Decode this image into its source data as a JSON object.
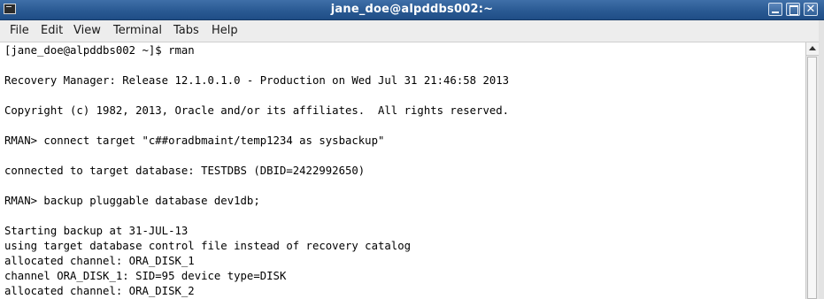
{
  "window": {
    "title": "jane_doe@alpddbs002:~",
    "app_icon": "terminal-icon",
    "controls": {
      "minimize_icon": "minimize-icon",
      "maximize_icon": "maximize-icon",
      "close_icon": "close-icon",
      "close_glyph": "✕"
    }
  },
  "colors": {
    "titlebar": "#2a5a93",
    "terminal_bg": "#ffffff",
    "terminal_fg": "#000000",
    "menubar_bg": "#ededed"
  },
  "menu": {
    "items": [
      "File",
      "Edit",
      "View",
      "Terminal",
      "Tabs",
      "Help"
    ]
  },
  "terminal": {
    "lines": [
      "[jane_doe@alpddbs002 ~]$ rman",
      "",
      "Recovery Manager: Release 12.1.0.1.0 - Production on Wed Jul 31 21:46:58 2013",
      "",
      "Copyright (c) 1982, 2013, Oracle and/or its affiliates.  All rights reserved.",
      "",
      "RMAN> connect target \"c##oradbmaint/temp1234 as sysbackup\"",
      "",
      "connected to target database: TESTDBS (DBID=2422992650)",
      "",
      "RMAN> backup pluggable database dev1db;",
      "",
      "Starting backup at 31-JUL-13",
      "using target database control file instead of recovery catalog",
      "allocated channel: ORA_DISK_1",
      "channel ORA_DISK_1: SID=95 device type=DISK",
      "allocated channel: ORA_DISK_2"
    ]
  }
}
